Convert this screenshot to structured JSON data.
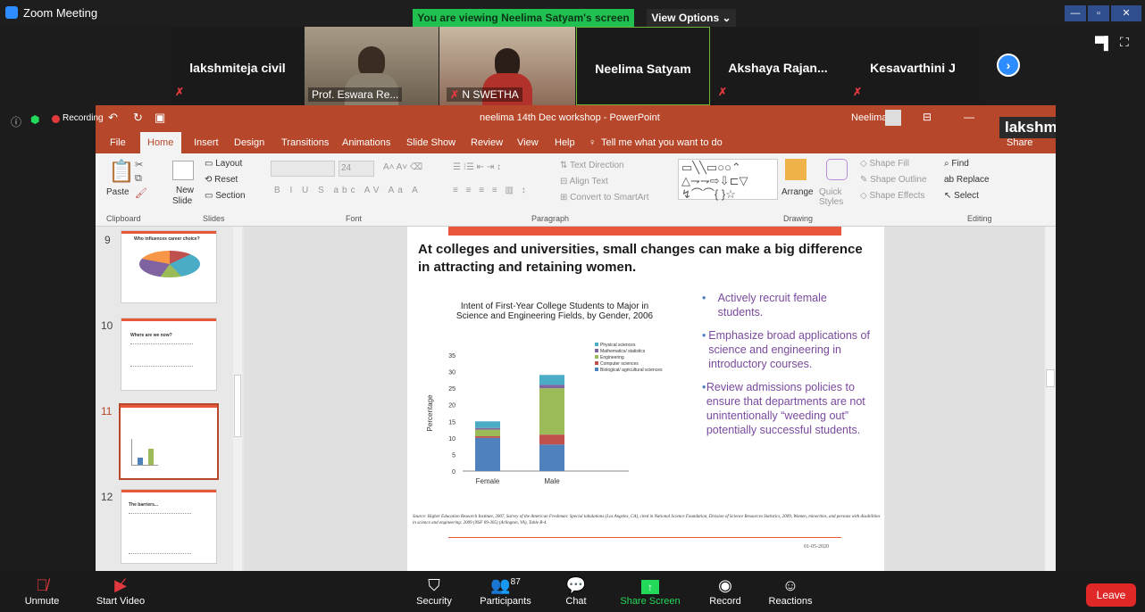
{
  "window": {
    "title": "Zoom Meeting",
    "share_notice": "You are viewing Neelima Satyam's screen",
    "view_options": "View Options"
  },
  "gallery": [
    {
      "name": "lakshmiteja civil",
      "muted": true
    },
    {
      "name": "Prof. Eswara Re...",
      "video": true
    },
    {
      "name": "N SWETHA",
      "video": true,
      "muted": true
    },
    {
      "name": "Neelima Satyam",
      "active": true
    },
    {
      "name": "Akshaya Rajan...",
      "muted": true
    },
    {
      "name": "Kesavarthini J",
      "muted": true
    }
  ],
  "recording": "Recording",
  "watermark_name": "lakshmiteja.p",
  "ppt": {
    "title": "neelima 14th Dec workshop - PowerPoint",
    "user": "Neelima",
    "tabs": [
      "File",
      "Home",
      "Insert",
      "Design",
      "Transitions",
      "Animations",
      "Slide Show",
      "Review",
      "View",
      "Help"
    ],
    "tell_me": "Tell me what you want to do",
    "share": "Share",
    "ribbon": {
      "paste": "Paste",
      "new_slide": "New",
      "new_slide2": "Slide",
      "layout": "Layout",
      "reset": "Reset",
      "section": "Section",
      "font_size": "24",
      "text_direction": "Text Direction",
      "align_text": "Align Text",
      "convert_smartart": "Convert to SmartArt",
      "arrange": "Arrange",
      "quick_styles": "Quick Styles",
      "shape_fill": "Shape Fill",
      "shape_outline": "Shape Outline",
      "shape_effects": "Shape Effects",
      "find": "Find",
      "replace": "Replace",
      "select": "Select",
      "groups": [
        "Clipboard",
        "Slides",
        "Font",
        "Paragraph",
        "Drawing",
        "Editing"
      ]
    },
    "thumbnails": [
      {
        "num": "9",
        "title": "Who influences career choice?"
      },
      {
        "num": "10",
        "title": "Where are we now?"
      },
      {
        "num": "11",
        "title": ""
      },
      {
        "num": "12",
        "title": "The barriers..."
      }
    ],
    "slide": {
      "headline": "At colleges and universities, small changes can make a big difference in attracting and retaining women.",
      "chart_title_1": "Intent of First-Year College Students to Major in",
      "chart_title_2": "Science and Engineering Fields, by Gender, 2006",
      "bullets": [
        "Actively recruit female students.",
        "Emphasize broad applications of science and engineering in introductory courses.",
        "Review admissions policies to ensure that departments are not unintentionally “weeding out” potentially successful students."
      ],
      "source": "Source: Higher Education Research Institute, 2007, Survey of the American Freshman: Special tabulations (Los Angeles, CA), cited in National Science Foundation, Division of Science Resources Statistics, 2009, Women, minorities, and persons with disabilities in science and engineering: 2009 (NSF 09-305) (Arlington, VA), Table B-4.",
      "date": "01-05-2020",
      "colors": {
        "accent": "#e8573a",
        "bullet": "#7a4a9e"
      }
    }
  },
  "chart_data": {
    "type": "bar",
    "title": "Intent of First-Year College Students to Major in Science and Engineering Fields, by Gender, 2006",
    "ylabel": "Percentage",
    "categories": [
      "Female",
      "Male"
    ],
    "ylim": [
      0,
      35
    ],
    "yticks": [
      0,
      5,
      10,
      15,
      20,
      25,
      30,
      35
    ],
    "stacked": true,
    "series": [
      {
        "name": "Biological/ agricultural sciences",
        "values": [
          10,
          8
        ],
        "color": "#4f81bd"
      },
      {
        "name": "Computer sciences",
        "values": [
          0.5,
          3
        ],
        "color": "#c0504d"
      },
      {
        "name": "Engineering",
        "values": [
          2,
          14
        ],
        "color": "#9bbb59"
      },
      {
        "name": "Mathematics/ statistics",
        "values": [
          0.5,
          1
        ],
        "color": "#8064a2"
      },
      {
        "name": "Physical sciences",
        "values": [
          2,
          3
        ],
        "color": "#4bacc6"
      }
    ]
  },
  "toolbar": {
    "unmute": "Unmute",
    "start_video": "Start Video",
    "security": "Security",
    "participants": "Participants",
    "participant_count": "87",
    "chat": "Chat",
    "share_screen": "Share Screen",
    "record": "Record",
    "reactions": "Reactions",
    "leave": "Leave"
  }
}
